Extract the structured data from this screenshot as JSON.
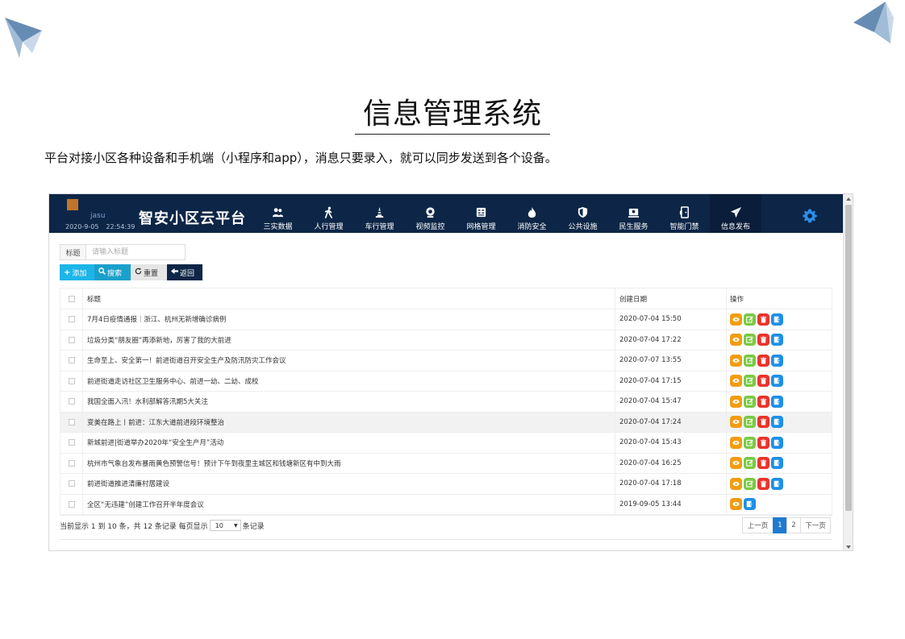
{
  "slide": {
    "title": "信息管理系统",
    "subtitle": "平台对接小区各种设备和手机端（小程序和app），消息只要录入，就可以同步发送到各个设备。"
  },
  "app": {
    "logo_text": "jasu",
    "date": "2020-9-05",
    "time": "22:54:39",
    "brand": "智安小区云平台",
    "nav": [
      {
        "label": "三实数据",
        "icon": "people-icon"
      },
      {
        "label": "人行管理",
        "icon": "walking-person-icon"
      },
      {
        "label": "车行管理",
        "icon": "traffic-cone-icon"
      },
      {
        "label": "视频监控",
        "icon": "webcam-icon"
      },
      {
        "label": "网格管理",
        "icon": "grid-table-icon"
      },
      {
        "label": "消防安全",
        "icon": "flame-icon"
      },
      {
        "label": "公共设施",
        "icon": "shield-icon"
      },
      {
        "label": "民生服务",
        "icon": "service-icon"
      },
      {
        "label": "智能门禁",
        "icon": "door-access-icon"
      },
      {
        "label": "信息发布",
        "icon": "paper-plane-icon"
      }
    ],
    "active_nav": "信息发布",
    "settings_icon": "gear-icon"
  },
  "search": {
    "label": "标题",
    "placeholder": "请输入标题"
  },
  "toolbar": {
    "add_label": "添加",
    "search_label": "搜索",
    "reset_label": "重置",
    "back_label": "返回"
  },
  "table": {
    "headers": {
      "title": "标题",
      "date": "创建日期",
      "ops": "操作"
    },
    "rows": [
      {
        "title": "7月4日疫情通报｜浙江、杭州无新增确诊病例",
        "date": "2020-07-04 15:50",
        "ops": [
          "view",
          "edit",
          "delete",
          "publish"
        ]
      },
      {
        "title": "垃圾分类“朋友圈”再添新地，厉害了我的大前进",
        "date": "2020-07-04 17:22",
        "ops": [
          "view",
          "edit",
          "delete",
          "publish"
        ]
      },
      {
        "title": "生命至上、安全第一！前进街道召开安全生产及防汛防灾工作会议",
        "date": "2020-07-07 13:55",
        "ops": [
          "view",
          "edit",
          "delete",
          "publish"
        ]
      },
      {
        "title": "前进街道走访社区卫生服务中心、前进一幼、二幼、成校",
        "date": "2020-07-04 17:15",
        "ops": [
          "view",
          "edit",
          "delete",
          "publish"
        ]
      },
      {
        "title": "我国全面入汛！水利部解答汛期5大关注",
        "date": "2020-07-04 15:47",
        "ops": [
          "view",
          "edit",
          "delete",
          "publish"
        ]
      },
      {
        "title": "变美在路上丨前进：江东大道前进段环境整治",
        "date": "2020-07-04 17:24",
        "ops": [
          "view",
          "edit",
          "delete",
          "publish"
        ]
      },
      {
        "title": "新城前进|街道举办2020年“安全生产月”活动",
        "date": "2020-07-04 15:43",
        "ops": [
          "view",
          "edit",
          "delete",
          "publish"
        ]
      },
      {
        "title": "杭州市气象台发布暴雨黄色预警信号！预计下午到夜里主城区和钱塘新区有中到大雨",
        "date": "2020-07-04 16:25",
        "ops": [
          "view",
          "edit",
          "delete",
          "publish"
        ]
      },
      {
        "title": "前进街道推进清廉村居建设",
        "date": "2020-07-04 17:18",
        "ops": [
          "view",
          "edit",
          "delete",
          "publish"
        ]
      },
      {
        "title": "全区“无违建”创建工作召开半年度会议",
        "date": "2019-09-05 13:44",
        "ops": [
          "view",
          "publish"
        ]
      }
    ],
    "highlighted_row": 5
  },
  "pagination": {
    "info_prefix": "当前显示 1 到 10 条，共 12 条记录 每页显示",
    "page_size": "10",
    "info_suffix": "条记录",
    "prev_label": "上一页",
    "pages": [
      "1",
      "2"
    ],
    "current_page": "1",
    "next_label": "下一页"
  },
  "colors": {
    "header_bg": "#0d2647",
    "accent_add": "#1cb5e8",
    "op_view": "#f39c12",
    "op_edit": "#7ac943",
    "op_delete": "#e8342c",
    "op_publish": "#1e90e6"
  }
}
